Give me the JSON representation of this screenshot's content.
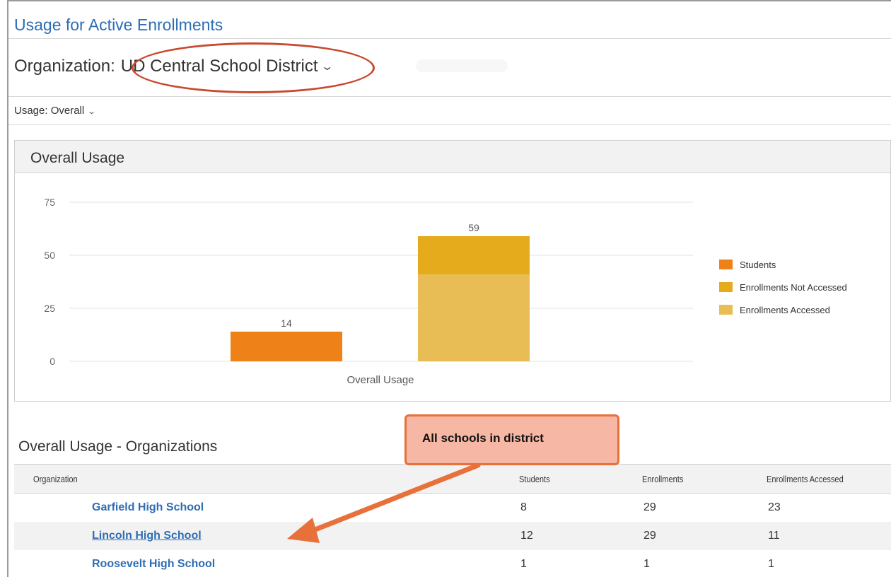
{
  "page": {
    "title": "Usage for Active Enrollments",
    "organization_label": "Organization:",
    "organization_value": "UD Central School District",
    "usage_select": "Usage: Overall"
  },
  "panel": {
    "title": "Overall Usage"
  },
  "chart_data": {
    "type": "bar",
    "categories": [
      "Overall Usage"
    ],
    "ylim": [
      0,
      75
    ],
    "yticks": [
      0,
      25,
      50,
      75
    ],
    "grid": true,
    "legend_position": "right",
    "series": [
      {
        "name": "Students",
        "values": [
          14
        ],
        "color": "#ee8219"
      },
      {
        "name": "Enrollments Not Accessed",
        "values": [
          18
        ],
        "color": "#e6ab1c"
      },
      {
        "name": "Enrollments Accessed",
        "values": [
          41
        ],
        "color": "#e8bd55"
      }
    ],
    "stacked_total_label": "59",
    "students_label": "14",
    "xlabel": "Overall Usage"
  },
  "section": {
    "title": "Overall Usage - Organizations"
  },
  "table": {
    "columns": [
      "Organization",
      "Students",
      "Enrollments",
      "Enrollments Accessed"
    ],
    "rows": [
      {
        "organization": "Garfield High School",
        "students": "8",
        "enrollments": "29",
        "accessed": "23"
      },
      {
        "organization": "Lincoln High School",
        "students": "12",
        "enrollments": "29",
        "accessed": "11"
      },
      {
        "organization": "Roosevelt High School",
        "students": "1",
        "enrollments": "1",
        "accessed": "1"
      }
    ]
  },
  "annotation": {
    "callout_text": "All schools in district",
    "callout_color": "#f6b8a4",
    "highlight_color": "#c9492e"
  }
}
